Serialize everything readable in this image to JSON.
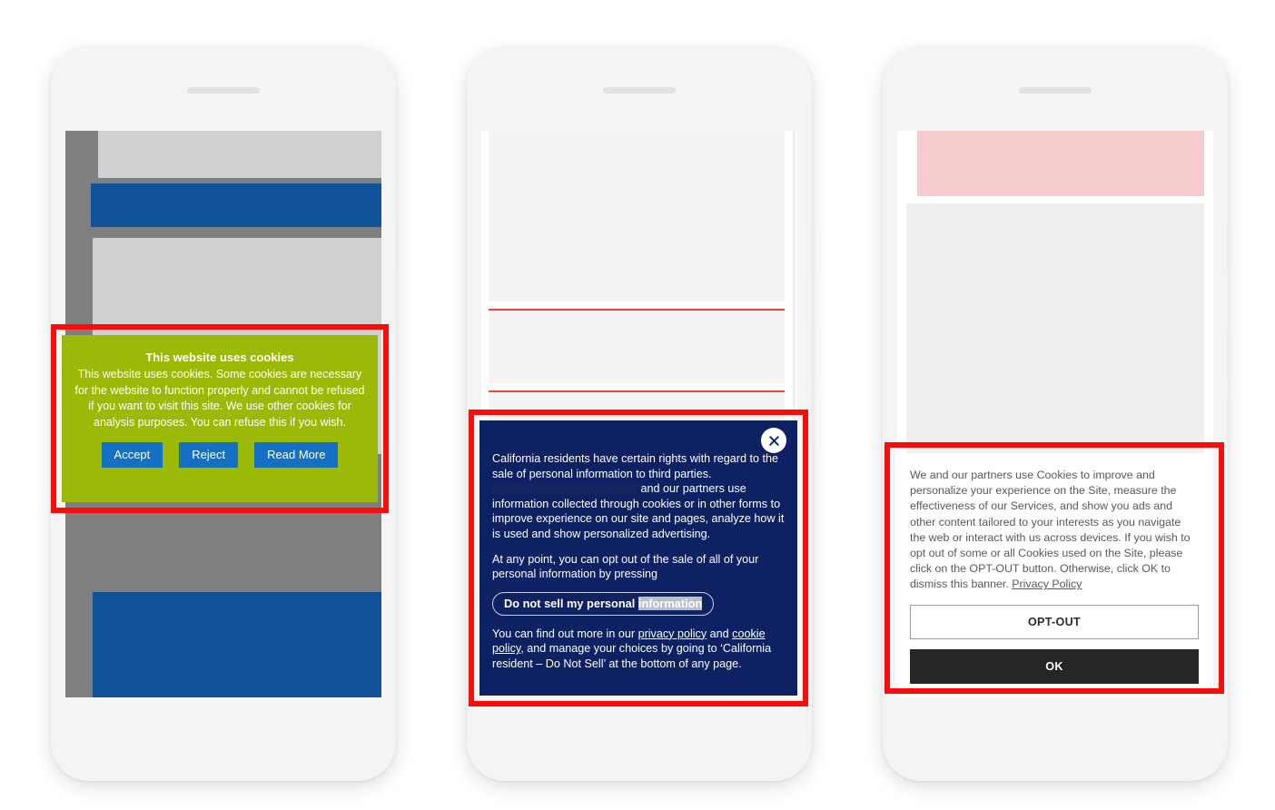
{
  "page": {
    "background_color": "#ffffff",
    "annotation_color": "#fb0b0b"
  },
  "phones": [
    {
      "id": "phone-1",
      "screen_background": "#7f7f7f",
      "banner": {
        "kind": "green-cookie-consent",
        "background_color": "#9aba07",
        "title": "This website uses cookies",
        "body": "This website uses cookies. Some cookies are necessary for the website to function properly and cannot be refused if you want to visit this site. We use other cookies for analysis purposes. You can refuse this if you wish.",
        "buttons": [
          {
            "label": "Accept",
            "color": "#1570c4"
          },
          {
            "label": "Reject",
            "color": "#1570c4"
          },
          {
            "label": "Read More",
            "color": "#1570c4"
          }
        ]
      }
    },
    {
      "id": "phone-2",
      "screen_background": "#ffffff",
      "banner": {
        "kind": "navy-ccpa-notice",
        "background_color": "#0e2162",
        "close_icon": "close-x-icon",
        "paragraph_1_part_1": "California residents have certain rights with regard to the sale of personal information to third parties.",
        "paragraph_1_part_2": "and our partners use information collected through cookies or in other forms to improve experience on our site and pages, analyze how it is used and show personalized advertising.",
        "paragraph_2": "At any point, you can opt out of the sale of all of your personal information by pressing",
        "pill_text_normal": "Do not sell my personal",
        "pill_text_selected": "information",
        "paragraph_3_part_1": "You can find out more in our",
        "link_privacy": "privacy policy",
        "paragraph_3_and": "and",
        "link_cookie": "cookie policy",
        "paragraph_3_part_2": ", and manage your choices by going to ‘California resident – Do Not Sell’ at the bottom of any page."
      }
    },
    {
      "id": "phone-3",
      "screen_background": "#ffffff",
      "banner": {
        "kind": "white-optout-notice",
        "background_color": "#ffffff",
        "body": "We and our partners use Cookies to improve and personalize your experience on the Site, measure the effectiveness of our Services, and show you ads and other content tailored to your interests as you navigate the web or interact with us across devices. If you wish to opt out of some or all Cookies used on the Site, please click on the OPT-OUT button. Otherwise, click OK to dismiss this banner.",
        "link_privacy_policy": "Privacy Policy",
        "buttons": [
          {
            "label": "OPT-OUT",
            "style": "outline",
            "color": "#ffffff"
          },
          {
            "label": "OK",
            "style": "solid",
            "color": "#262626"
          }
        ]
      }
    }
  ]
}
